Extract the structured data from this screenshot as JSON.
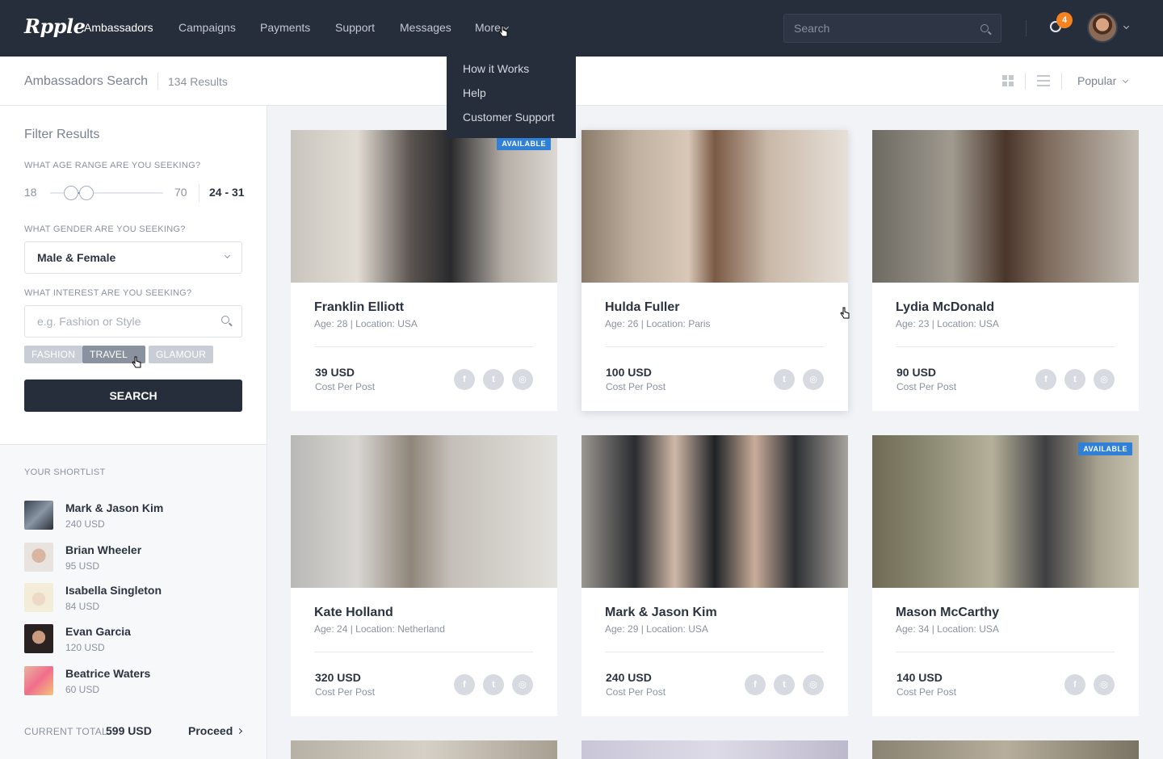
{
  "nav": {
    "logo": "Rpple",
    "links": [
      "Ambassadors",
      "Campaigns",
      "Payments",
      "Support",
      "Messages",
      "More"
    ],
    "active": "Ambassadors",
    "search_placeholder": "Search",
    "notifications": "4",
    "more_menu": [
      "How it Works",
      "Help",
      "Customer Support"
    ]
  },
  "subheader": {
    "title": "Ambassadors Search",
    "results": "134 Results",
    "sort": "Popular"
  },
  "filters": {
    "title": "Filter Results",
    "age_label": "WHAT AGE RANGE ARE YOU SEEKING?",
    "age_min": "18",
    "age_max": "70",
    "age_selected": "24 - 31",
    "age_low": 24,
    "age_high": 31,
    "gender_label": "WHAT GENDER ARE YOU SEEKING?",
    "gender_value": "Male & Female",
    "interest_label": "WHAT INTEREST ARE YOU SEEKING?",
    "interest_placeholder": "e.g. Fashion or Style",
    "tags": [
      "FASHION",
      "TRAVEL",
      "GLAMOUR"
    ],
    "active_tag": "TRAVEL",
    "search_button": "SEARCH"
  },
  "shortlist": {
    "title": "YOUR SHORTLIST",
    "items": [
      {
        "name": "Mark & Jason Kim",
        "price": "240 USD"
      },
      {
        "name": "Brian Wheeler",
        "price": "95 USD"
      },
      {
        "name": "Isabella Singleton",
        "price": "84 USD"
      },
      {
        "name": "Evan Garcia",
        "price": "120 USD"
      },
      {
        "name": "Beatrice Waters",
        "price": "60 USD"
      }
    ],
    "total_label": "CURRENT TOTAL:",
    "total_value": "599 USD",
    "proceed": "Proceed"
  },
  "cards": [
    {
      "name": "Franklin Elliott",
      "meta": "Age: 28  |  Location: USA",
      "price": "39 USD",
      "cpp": "Cost Per Post",
      "available": "AVAILABLE",
      "social": [
        "facebook",
        "twitter",
        "instagram"
      ]
    },
    {
      "name": "Hulda Fuller",
      "meta": "Age: 26  |  Location: Paris",
      "price": "100 USD",
      "cpp": "Cost Per Post",
      "available": "",
      "social": [
        "twitter",
        "instagram"
      ]
    },
    {
      "name": "Lydia McDonald",
      "meta": "Age: 23  |  Location: USA",
      "price": "90 USD",
      "cpp": "Cost Per Post",
      "available": "",
      "social": [
        "facebook",
        "twitter",
        "instagram"
      ]
    },
    {
      "name": "Kate Holland",
      "meta": "Age: 24  |  Location: Netherland",
      "price": "320 USD",
      "cpp": "Cost Per Post",
      "available": "",
      "social": [
        "facebook",
        "twitter",
        "instagram"
      ]
    },
    {
      "name": "Mark & Jason Kim",
      "meta": "Age: 29  |  Location: USA",
      "price": "240 USD",
      "cpp": "Cost Per Post",
      "available": "",
      "social": [
        "facebook",
        "twitter",
        "instagram"
      ]
    },
    {
      "name": "Mason McCarthy",
      "meta": "Age: 34  |  Location: USA",
      "price": "140 USD",
      "cpp": "Cost Per Post",
      "available": "AVAILABLE",
      "social": [
        "facebook",
        "instagram"
      ]
    }
  ],
  "colors": {
    "nav_bg": "#262d3b",
    "accent": "#4a90e2",
    "badge": "#2f80d6",
    "notification": "#f5821f"
  }
}
